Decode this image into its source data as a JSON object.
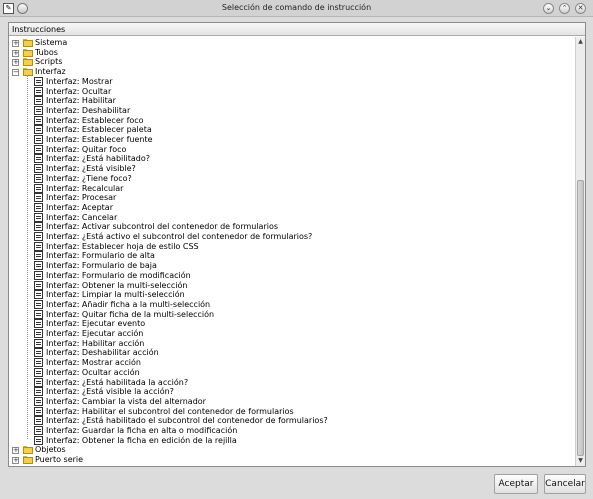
{
  "window": {
    "title": "Selección de comando de instrucción",
    "window_icon": "document-icon",
    "controls": [
      "minimize-icon",
      "maximize-icon",
      "close-icon"
    ]
  },
  "tree": {
    "header": "Instrucciones",
    "nodes": [
      {
        "label": "Sistema",
        "expanded": false
      },
      {
        "label": "Tubos",
        "expanded": false
      },
      {
        "label": "Scripts",
        "expanded": false
      },
      {
        "label": "Interfaz",
        "expanded": true,
        "children": [
          "Interfaz: Mostrar",
          "Interfaz: Ocultar",
          "Interfaz: Habilitar",
          "Interfaz: Deshabilitar",
          "Interfaz: Establecer foco",
          "Interfaz: Establecer paleta",
          "Interfaz: Establecer fuente",
          "Interfaz: Quitar foco",
          "Interfaz: ¿Está habilitado?",
          "Interfaz: ¿Está visible?",
          "Interfaz: ¿Tiene foco?",
          "Interfaz: Recalcular",
          "Interfaz: Procesar",
          "Interfaz: Aceptar",
          "Interfaz: Cancelar",
          "Interfaz: Activar subcontrol del contenedor de formularios",
          "Interfaz: ¿Está activo el subcontrol del contenedor de formularios?",
          "Interfaz: Establecer hoja de estilo CSS",
          "Interfaz: Formulario de alta",
          "Interfaz: Formulario de baja",
          "Interfaz: Formulario de modificación",
          "Interfaz: Obtener la multi-selección",
          "Interfaz: Limpiar la multi-selección",
          "Interfaz: Añadir ficha a la multi-selección",
          "Interfaz: Quitar ficha de la multi-selección",
          "Interfaz: Ejecutar evento",
          "Interfaz: Ejecutar acción",
          "Interfaz: Habilitar acción",
          "Interfaz: Deshabilitar acción",
          "Interfaz: Mostrar acción",
          "Interfaz: Ocultar acción",
          "Interfaz: ¿Está habilitada la acción?",
          "Interfaz: ¿Está visible la acción?",
          "Interfaz: Cambiar la vista del alternador",
          "Interfaz: Habilitar el subcontrol del contenedor de formularios",
          "Interfaz: ¿Está habilitado el subcontrol del contenedor de formularios?",
          "Interfaz: Guardar la ficha en alta o modificación",
          "Interfaz: Obtener la ficha en edición de la rejilla"
        ]
      },
      {
        "label": "Objetos",
        "expanded": false
      },
      {
        "label": "Puerto serie",
        "expanded": false
      }
    ],
    "icons": {
      "folder": "folder-icon",
      "item": "command-icon",
      "expand": "plus",
      "collapse": "minus"
    }
  },
  "buttons": {
    "accept": "Aceptar",
    "cancel": "Cancelar"
  }
}
